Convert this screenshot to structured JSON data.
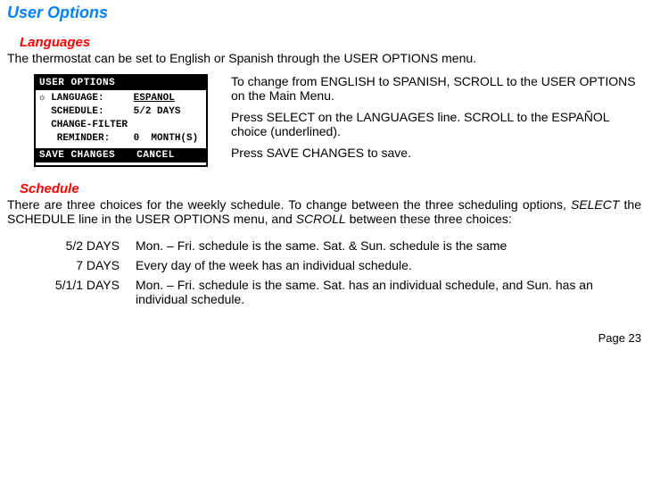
{
  "pageTitle": "User Options",
  "languages": {
    "heading": "Languages",
    "intro": "The thermostat can be set to English or Spanish through the USER OPTIONS menu.",
    "lcd": {
      "header": "USER OPTIONS",
      "line1_a": "☼ LANGUAGE:     ",
      "line1_b": "ESPANOL",
      "line2": "  SCHEDULE:     5/2 DAYS",
      "line3": "  CHANGE-FILTER",
      "line4": "   REMINDER:    0  MONTH(S)",
      "footerLeft": "  SAVE CHANGES",
      "footerRight": "  CANCEL "
    },
    "instructions": {
      "p1": "To change from ENGLISH to SPANISH, SCROLL to the USER OPTIONS on the Main Menu.",
      "p2": "Press SELECT on the LANGUAGES line.  SCROLL to the ESPAÑOL choice (underlined).",
      "p3": "Press SAVE CHANGES to save."
    }
  },
  "schedule": {
    "heading": "Schedule",
    "intro_a": "There are three choices for the weekly schedule. To change between the three scheduling options, ",
    "intro_b": "SELECT",
    "intro_c": " the SCHEDULE line in the USER OPTIONS menu, and ",
    "intro_d": "SCROLL",
    "intro_e": " between these three choices:",
    "items": [
      {
        "term": "5/2 DAYS",
        "desc": "Mon. – Fri. schedule is the same. Sat. & Sun. schedule is the same"
      },
      {
        "term": "7 DAYS",
        "desc": "Every day of the week has an individual schedule."
      },
      {
        "term": "5/1/1 DAYS",
        "desc": "Mon. – Fri. schedule is the same. Sat. has an individual schedule, and Sun. has an individual schedule."
      }
    ]
  },
  "footer": "Page 23"
}
